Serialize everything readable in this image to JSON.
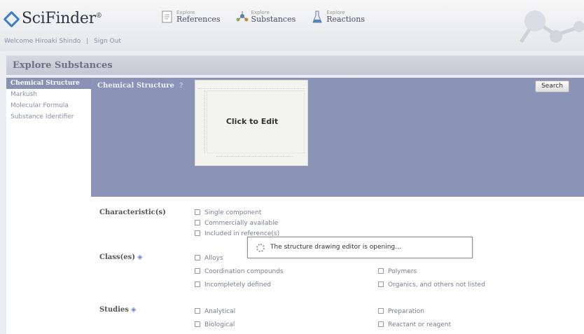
{
  "brand": {
    "name": "SciFinder",
    "mark": "®"
  },
  "nav": [
    {
      "small": "Explore",
      "big": "References",
      "icon": "document-icon"
    },
    {
      "small": "Explore",
      "big": "Substances",
      "icon": "flask-icon"
    },
    {
      "small": "Explore",
      "big": "Reactions",
      "icon": "beaker-icon"
    }
  ],
  "user": {
    "welcome": "Welcome Hiroaki Shindo",
    "separator": "|",
    "signout": "Sign Out"
  },
  "section_title": "Explore Substances",
  "left_menu": [
    {
      "label": "Chemical Structure",
      "active": true
    },
    {
      "label": "Markush",
      "active": false
    },
    {
      "label": "Molecular Formula",
      "active": false
    },
    {
      "label": "Substance Identifier",
      "active": false
    }
  ],
  "panel": {
    "label": "Chemical Structure",
    "help": "?",
    "editor_cta": "Click to Edit",
    "search_button": "Search"
  },
  "form": {
    "characteristics": {
      "label": "Characteristic(s)",
      "options": [
        "Single component",
        "Commercially available",
        "Included in reference(s)"
      ]
    },
    "classes": {
      "label": "Class(es)",
      "left": [
        "Alloys",
        "Coordination compounds",
        "Incompletely defined"
      ],
      "right": [
        "Polymers",
        "Organics, and others not listed"
      ]
    },
    "studies": {
      "label": "Studies",
      "left": [
        "Analytical",
        "Biological"
      ],
      "right": [
        "Preparation",
        "Reactant or reagent"
      ]
    }
  },
  "loading_popup": {
    "message": "The structure drawing editor is opening..."
  },
  "colors": {
    "panel_blue": "#8b93b6",
    "menu_active": "#8a91b5",
    "logo_blue": "#3a7dcc"
  }
}
